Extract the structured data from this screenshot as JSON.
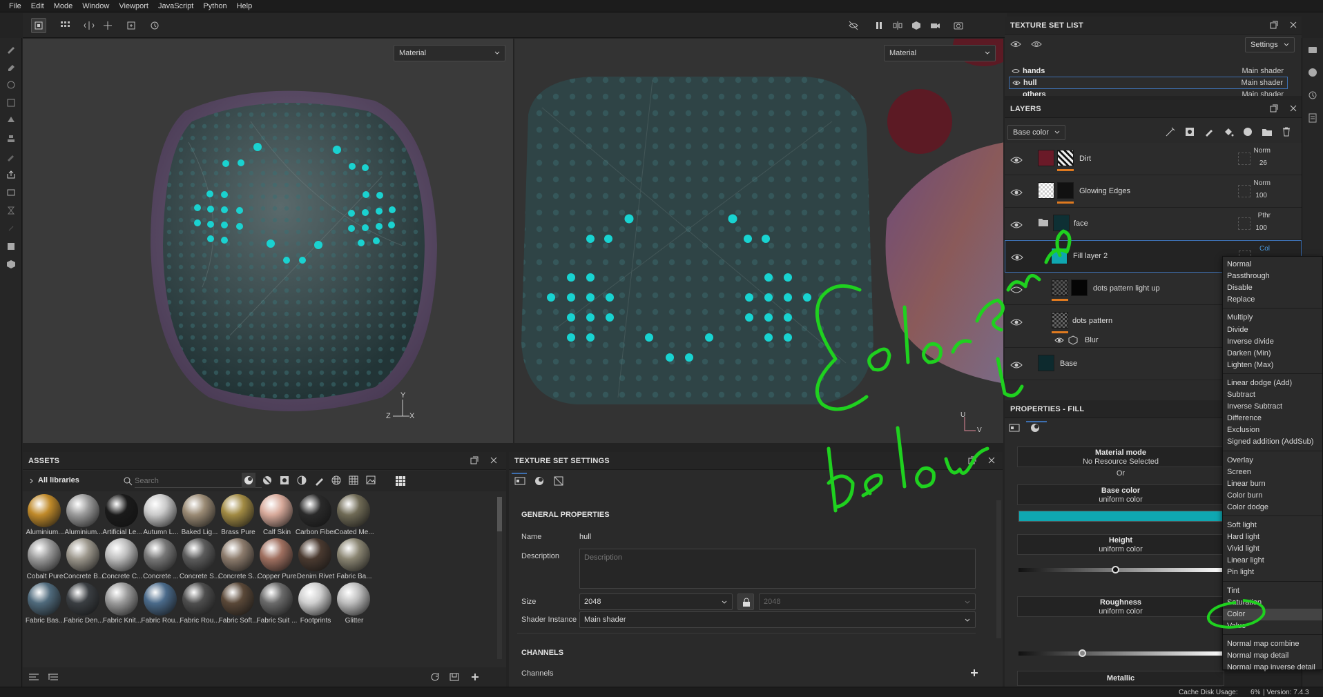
{
  "menubar": {
    "items": [
      "File",
      "Edit",
      "Mode",
      "Window",
      "Viewport",
      "JavaScript",
      "Python",
      "Help"
    ]
  },
  "viewport": {
    "left_mode": "Material",
    "right_mode": "Material",
    "axis_3d": {
      "y": "Y",
      "z": "Z",
      "x": "X"
    },
    "axis_2d": {
      "u": "U",
      "v": "V"
    }
  },
  "texture_set_list": {
    "title": "TEXTURE SET LIST",
    "settings_label": "Settings",
    "rows": [
      {
        "name": "hands",
        "shader": "Main shader"
      },
      {
        "name": "hull",
        "shader": "Main shader"
      },
      {
        "name": "others",
        "shader": "Main shader"
      }
    ]
  },
  "layers": {
    "title": "LAYERS",
    "channel": "Base color",
    "items": [
      {
        "name": "Dirt",
        "blend": "Norm",
        "opacity": "26"
      },
      {
        "name": "Glowing Edges",
        "blend": "Norm",
        "opacity": "100"
      },
      {
        "name": "face",
        "blend": "Pthr",
        "opacity": "100"
      },
      {
        "name": "Fill layer 2",
        "blend": "Col"
      },
      {
        "name": "dots pattern light up"
      },
      {
        "name": "dots pattern"
      },
      {
        "name": "Blur"
      },
      {
        "name": "Base"
      }
    ]
  },
  "blend_menu": {
    "items": [
      "Normal",
      "Passthrough",
      "Disable",
      "Replace",
      "Multiply",
      "Divide",
      "Inverse divide",
      "Darken (Min)",
      "Lighten (Max)",
      "Linear dodge (Add)",
      "Subtract",
      "Inverse Subtract",
      "Difference",
      "Exclusion",
      "Signed addition (AddSub)",
      "Overlay",
      "Screen",
      "Linear burn",
      "Color burn",
      "Color dodge",
      "Soft light",
      "Hard light",
      "Vivid light",
      "Linear light",
      "Pin light",
      "Tint",
      "Saturation",
      "Color",
      "Value",
      "Normal map combine",
      "Normal map detail",
      "Normal map inverse detail"
    ],
    "highlighted": "Color"
  },
  "properties": {
    "title": "PROPERTIES - FILL",
    "material_mode": "Material mode",
    "no_resource": "No Resource Selected",
    "or": "Or",
    "base_color": "Base color",
    "height": "Height",
    "roughness": "Roughness",
    "metallic": "Metallic",
    "uniform": "uniform color",
    "base_color_value": "#0fa7b1",
    "height_slider": 0.47,
    "roughness_slider": 0.31
  },
  "annotation": {
    "line1": "Color overlay",
    "line2": "below",
    "color": "#1fd11f"
  },
  "assets": {
    "title": "ASSETS",
    "library": "All libraries",
    "search_placeholder": "Search",
    "items": [
      {
        "label": "Aluminium...",
        "color": "#c08a2a"
      },
      {
        "label": "Aluminium...",
        "color": "#9a9a9a"
      },
      {
        "label": "Artificial Le...",
        "color": "#1a1a1a"
      },
      {
        "label": "Autumn L...",
        "color": "#c9c9c9"
      },
      {
        "label": "Baked Lig...",
        "color": "#9a8a74"
      },
      {
        "label": "Brass Pure",
        "color": "#a18a43"
      },
      {
        "label": "Calf Skin",
        "color": "#d7a99a"
      },
      {
        "label": "Carbon Fiber",
        "color": "#2a2a2a"
      },
      {
        "label": "Coated Me...",
        "color": "#6f6a55"
      },
      {
        "label": "Cobalt Pure",
        "color": "#9c9c9c"
      },
      {
        "label": "Concrete B...",
        "color": "#9c978c"
      },
      {
        "label": "Concrete C...",
        "color": "#bdbdbd"
      },
      {
        "label": "Concrete ...",
        "color": "#777"
      },
      {
        "label": "Concrete S...",
        "color": "#5c5c5c"
      },
      {
        "label": "Concrete S...",
        "color": "#8c7b6c"
      },
      {
        "label": "Copper Pure",
        "color": "#a07060"
      },
      {
        "label": "Denim Rivet",
        "color": "#4a3a30"
      },
      {
        "label": "Fabric Ba...",
        "color": "#8a8572"
      },
      {
        "label": "Fabric Bas...",
        "color": "#4f6a7c"
      },
      {
        "label": "Fabric Den...",
        "color": "#3a3e42"
      },
      {
        "label": "Fabric Knit...",
        "color": "#9a9a9a"
      },
      {
        "label": "Fabric Rou...",
        "color": "#4a6a8a"
      },
      {
        "label": "Fabric Rou...",
        "color": "#4e4e4e"
      },
      {
        "label": "Fabric Soft...",
        "color": "#5a4838"
      },
      {
        "label": "Fabric Suit ...",
        "color": "#6a6a6a"
      },
      {
        "label": "Footprints",
        "color": "#cfcfcf"
      },
      {
        "label": "Glitter",
        "color": "#bdbdbd"
      }
    ]
  },
  "tss": {
    "title": "TEXTURE SET SETTINGS",
    "general": "GENERAL PROPERTIES",
    "name_label": "Name",
    "name_value": "hull",
    "desc_label": "Description",
    "desc_placeholder": "Description",
    "size_label": "Size",
    "size_value": "2048",
    "size_value2": "2048",
    "shader_label": "Shader Instance",
    "shader_value": "Main shader",
    "channels_header": "CHANNELS",
    "channels_label": "Channels"
  },
  "status": {
    "cache": "Cache Disk Usage:",
    "pct": "6%",
    "version": "| Version: 7.4.3"
  }
}
